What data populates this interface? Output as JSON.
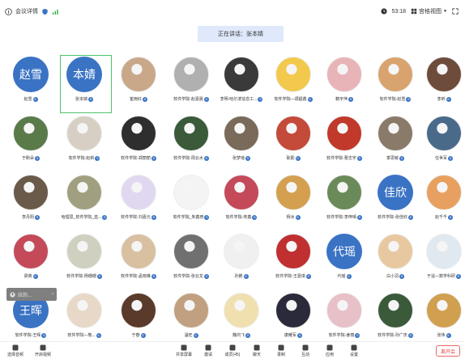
{
  "topbar": {
    "meeting_details": "会议详情",
    "timer": "53:18",
    "view_mode": "宫格视图"
  },
  "speaking_banner": "正在讲话：张本婧",
  "participants": [
    {
      "name": "赵雪",
      "avatar_text": "赵雪",
      "kind": "text"
    },
    {
      "name": "张本婧",
      "avatar_text": "本婧",
      "kind": "text",
      "selected": true
    },
    {
      "name": "崔雨红",
      "kind": "photo",
      "color": "#c9a88a"
    },
    {
      "name": "软件学院-赵嘉晨",
      "kind": "photo",
      "color": "#b0b0b0"
    },
    {
      "name": "李明-哈尔滨信息工...",
      "kind": "photo",
      "color": "#3a3a3a"
    },
    {
      "name": "软件学院—颂超鑫",
      "kind": "photo",
      "color": "#f2c94c"
    },
    {
      "name": "籍宇萍",
      "kind": "photo",
      "color": "#e8b4b8"
    },
    {
      "name": "软件学院-赵雪",
      "kind": "photo",
      "color": "#d9a36f"
    },
    {
      "name": "李昕",
      "kind": "photo",
      "color": "#6d4c3b"
    },
    {
      "name": "于盼朵",
      "kind": "photo",
      "color": "#5a7a4a"
    },
    {
      "name": "软件学院-赵新",
      "kind": "photo",
      "color": "#d8cfc4"
    },
    {
      "name": "软件学院-郑丽丽",
      "kind": "photo",
      "color": "#2e2e2e"
    },
    {
      "name": "软件学院-周云水",
      "kind": "photo",
      "color": "#3a5a3a"
    },
    {
      "name": "张梦瑶",
      "kind": "photo",
      "color": "#7a6a5a"
    },
    {
      "name": "耿勤",
      "kind": "photo",
      "color": "#c44a3a"
    },
    {
      "name": "软件学院-曹志宇",
      "kind": "photo",
      "color": "#c0392b"
    },
    {
      "name": "季思敏",
      "kind": "photo",
      "color": "#8a7a6a"
    },
    {
      "name": "任世军",
      "kind": "photo",
      "color": "#4a6a8a"
    },
    {
      "name": "李丹阳",
      "kind": "photo",
      "color": "#6a5a4a"
    },
    {
      "name": "哈理思_软件学院_蓝...",
      "kind": "photo",
      "color": "#a0a080"
    },
    {
      "name": "软件学院-刘嘉元",
      "kind": "photo",
      "color": "#e0d8f0"
    },
    {
      "name": "软件学院_朱鑫琦",
      "kind": "photo",
      "color": "#f4f4f4"
    },
    {
      "name": "软件学院-佟鑫",
      "kind": "photo",
      "color": "#c44a5a"
    },
    {
      "name": "杨冰",
      "kind": "photo",
      "color": "#d4a050"
    },
    {
      "name": "软件学院-李梓晴",
      "kind": "photo",
      "color": "#6a8a5a"
    },
    {
      "name": "软件学院-张佳欣",
      "avatar_text": "佳欣",
      "kind": "text"
    },
    {
      "name": "赵千千",
      "kind": "photo",
      "color": "#e8a060"
    },
    {
      "name": "梁爽",
      "kind": "photo",
      "color": "#c44a5a"
    },
    {
      "name": "软件学院-杨珊珊",
      "kind": "photo",
      "color": "#d0d0c0"
    },
    {
      "name": "软件学院-孟晓琳",
      "kind": "photo",
      "color": "#d8c0a0"
    },
    {
      "name": "软件学院-张云龙",
      "kind": "photo",
      "color": "#707070"
    },
    {
      "name": "孙鹏",
      "kind": "photo",
      "color": "#f0f0f0"
    },
    {
      "name": "软件学院-王嘉琪",
      "kind": "photo",
      "color": "#c03030"
    },
    {
      "name": "代瑶",
      "avatar_text": "代瑶",
      "kind": "text"
    },
    {
      "name": "白小羽",
      "kind": "photo",
      "color": "#e8c8a0"
    },
    {
      "name": "于遥—数学科研",
      "kind": "photo",
      "color": "#e0e8f0"
    },
    {
      "name": "软件学院-王晖",
      "avatar_text": "王晖",
      "kind": "text"
    },
    {
      "name": "软件学院—熊...",
      "kind": "photo",
      "color": "#e8d8c8"
    },
    {
      "name": "于春",
      "kind": "photo",
      "color": "#5a3a2a"
    },
    {
      "name": "温旺",
      "kind": "photo",
      "color": "#c0a080"
    },
    {
      "name": "魏鸿飞",
      "kind": "photo",
      "color": "#f0e0b0"
    },
    {
      "name": "康耀军",
      "kind": "photo",
      "color": "#2a2a3a"
    },
    {
      "name": "软件学院-姜丽",
      "kind": "photo",
      "color": "#e8c0c8"
    },
    {
      "name": "软件学院-孙广庆",
      "kind": "photo",
      "color": "#3a5a3a"
    },
    {
      "name": "张伟",
      "kind": "photo",
      "color": "#d0a050"
    }
  ],
  "floating": {
    "label": "应的..."
  },
  "bottombar": {
    "left": [
      {
        "label": "选择音频"
      },
      {
        "label": "开启视频"
      }
    ],
    "center": [
      {
        "label": "共享屏幕"
      },
      {
        "label": "邀请"
      },
      {
        "label": "成员(45)"
      },
      {
        "label": "聊天"
      },
      {
        "label": "录制"
      },
      {
        "label": "互动"
      },
      {
        "label": "应用"
      },
      {
        "label": "设置"
      }
    ],
    "leave_label": "离开会"
  }
}
